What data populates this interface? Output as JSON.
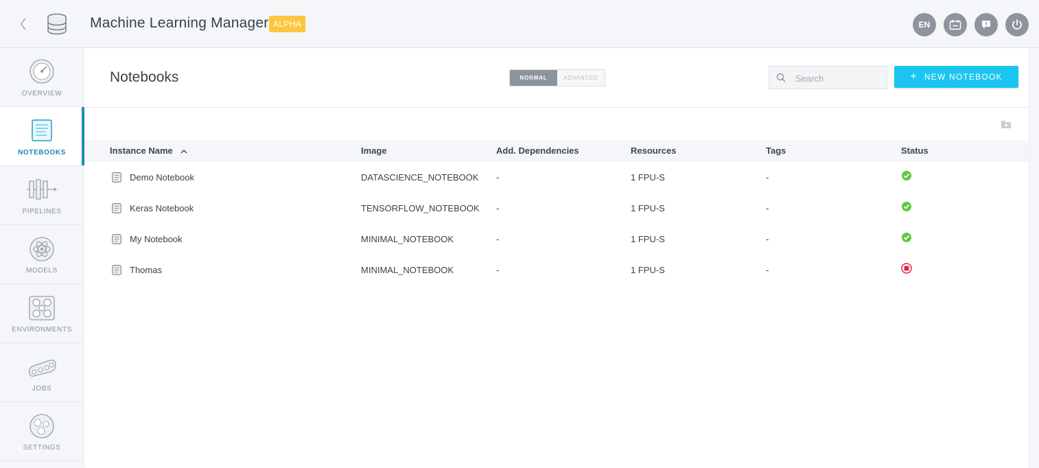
{
  "header": {
    "app_title": "Machine Learning Manager",
    "badge": "ALPHA",
    "language": "EN",
    "icons": [
      "chevron-left-icon",
      "database-icon",
      "calendar-icon",
      "help-chat-icon",
      "power-icon"
    ]
  },
  "sidebar": {
    "items": [
      {
        "label": "OVERVIEW",
        "icon": "dashboard-gauge-icon",
        "active": false
      },
      {
        "label": "NOTEBOOKS",
        "icon": "notebook-icon",
        "active": true
      },
      {
        "label": "PIPELINES",
        "icon": "pipeline-icon",
        "active": false
      },
      {
        "label": "MODELS",
        "icon": "atom-icon",
        "active": false
      },
      {
        "label": "ENVIRONMENTS",
        "icon": "network-grid-icon",
        "active": false
      },
      {
        "label": "JOBS",
        "icon": "conveyor-icon",
        "active": false
      },
      {
        "label": "SETTINGS",
        "icon": "gears-icon",
        "active": false
      }
    ]
  },
  "main": {
    "title": "Notebooks",
    "mode_toggle": {
      "normal": "NORMAL",
      "advanced": "ADVANCED",
      "selected": "NORMAL"
    },
    "search": {
      "placeholder": "Search",
      "value": ""
    },
    "new_button": "NEW NOTEBOOK",
    "table": {
      "columns": [
        "Instance Name",
        "Image",
        "Add. Dependencies",
        "Resources",
        "Tags",
        "Status"
      ],
      "sort": {
        "column": "Instance Name",
        "direction": "ascending"
      },
      "rows": [
        {
          "name": "Demo Notebook",
          "image": "DATASCIENCE_NOTEBOOK",
          "dependencies": "-",
          "resources": "1 FPU-S",
          "tags": "-",
          "status": "running"
        },
        {
          "name": "Keras Notebook",
          "image": "TENSORFLOW_NOTEBOOK",
          "dependencies": "-",
          "resources": "1 FPU-S",
          "tags": "-",
          "status": "running"
        },
        {
          "name": "My Notebook",
          "image": "MINIMAL_NOTEBOOK",
          "dependencies": "-",
          "resources": "1 FPU-S",
          "tags": "-",
          "status": "running"
        },
        {
          "name": "Thomas",
          "image": "MINIMAL_NOTEBOOK",
          "dependencies": "-",
          "resources": "1 FPU-S",
          "tags": "-",
          "status": "stopped"
        }
      ]
    }
  },
  "colors": {
    "accent": "#1ac6ef",
    "active_nav": "#1b87ad",
    "badge": "#fcc63f",
    "status_running": "#5ec943",
    "status_stopped": "#e5254b"
  }
}
